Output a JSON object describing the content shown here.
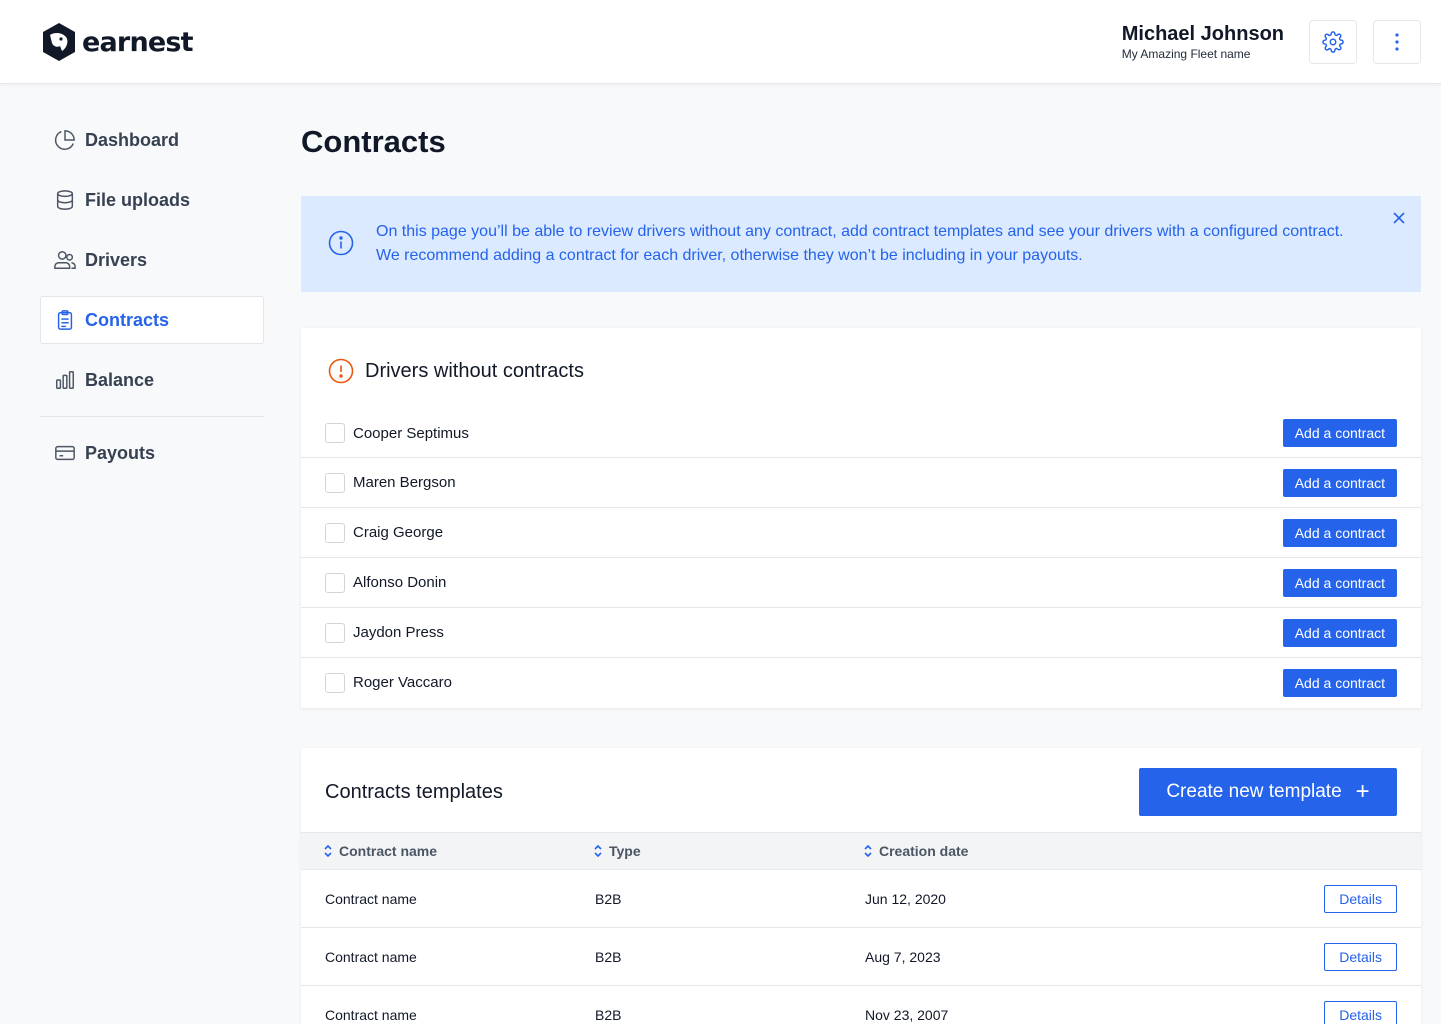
{
  "header": {
    "brand": "earnest",
    "user_name": "Michael Johnson",
    "fleet_name": "My Amazing Fleet name"
  },
  "sidebar": {
    "items": [
      {
        "label": "Dashboard",
        "icon": "pie-chart-icon"
      },
      {
        "label": "File uploads",
        "icon": "database-icon"
      },
      {
        "label": "Drivers",
        "icon": "users-icon"
      },
      {
        "label": "Contracts",
        "icon": "clipboard-icon",
        "active": true
      },
      {
        "label": "Balance",
        "icon": "bar-chart-icon"
      },
      {
        "label": "Payouts",
        "icon": "credit-card-icon"
      }
    ]
  },
  "page": {
    "title": "Contracts"
  },
  "alert": {
    "text": "On this page you’ll be able to review drivers without any contract, add contract templates and see your drivers with a configured contract. We recommend adding a contract for each driver, otherwise they won’t be including in your payouts."
  },
  "drivers_card": {
    "title": "Drivers without contracts",
    "action_label": "Add a contract",
    "drivers": [
      "Cooper Septimus",
      "Maren Bergson",
      "Craig George",
      "Alfonso Donin",
      "Jaydon Press",
      "Roger Vaccaro"
    ]
  },
  "templates_card": {
    "title": "Contracts templates",
    "create_label": "Create new template",
    "columns": [
      "Contract name",
      "Type",
      "Creation date"
    ],
    "details_label": "Details",
    "rows": [
      {
        "name": "Contract name",
        "type": "B2B",
        "date": "Jun 12, 2020"
      },
      {
        "name": "Contract name",
        "type": "B2B",
        "date": "Aug 7, 2023"
      },
      {
        "name": "Contract name",
        "type": "B2B",
        "date": "Nov 23, 2007"
      }
    ]
  },
  "colors": {
    "primary": "#2563eb",
    "alert_bg": "#dbeafe",
    "warning": "#ea580c"
  }
}
